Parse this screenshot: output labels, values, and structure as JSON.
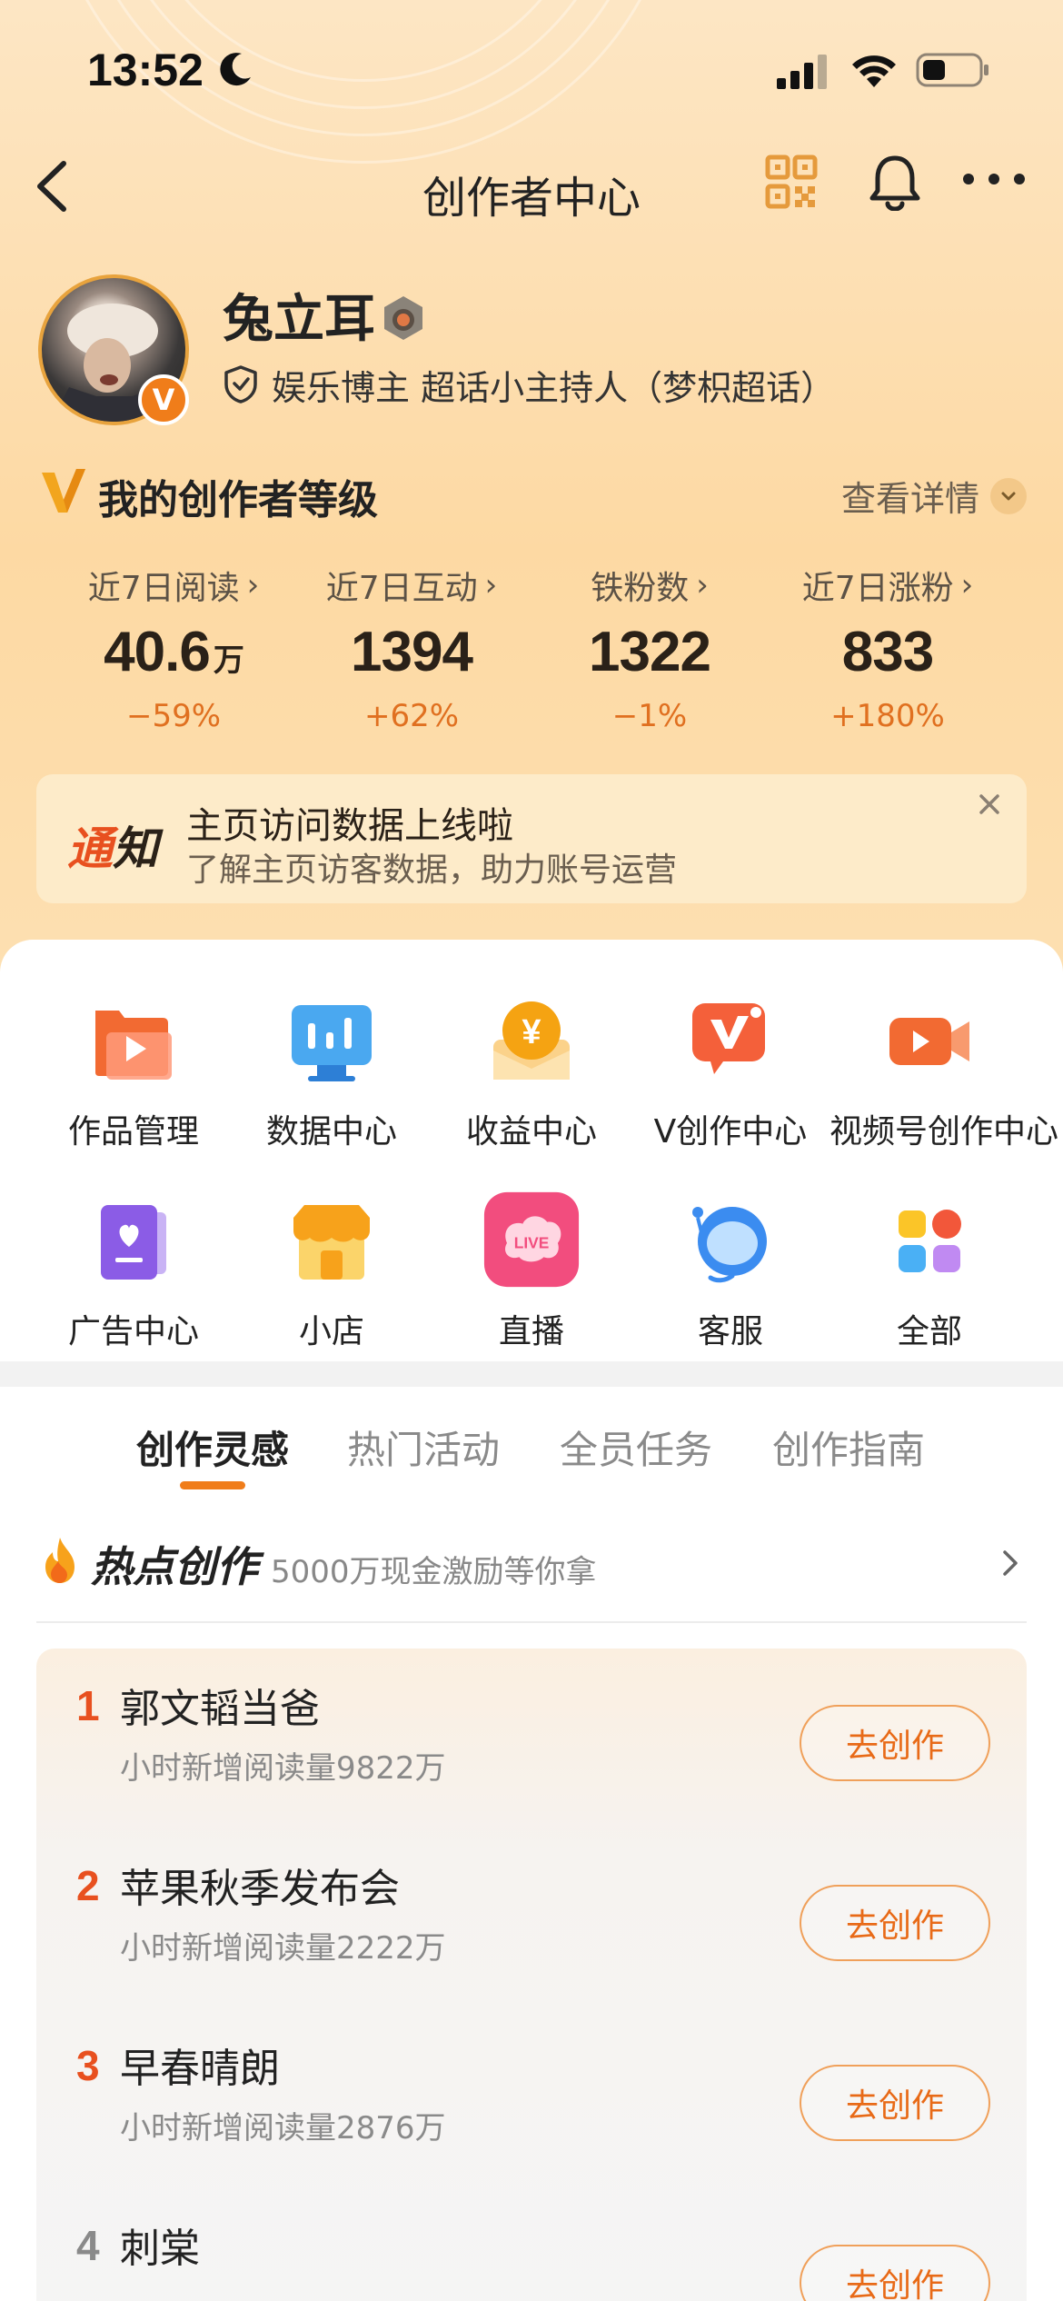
{
  "status_bar": {
    "time": "13:52"
  },
  "nav": {
    "title": "创作者中心"
  },
  "profile": {
    "username": "兔立耳",
    "avatar_badge": "V",
    "verification": "娱乐博主 超话小主持人（梦枳超话）"
  },
  "level": {
    "title": "我的创作者等级",
    "details_link": "查看详情"
  },
  "stats": [
    {
      "label": "近7日阅读",
      "value": "40.6",
      "unit": "万",
      "change": "−59%"
    },
    {
      "label": "近7日互动",
      "value": "1394",
      "unit": "",
      "change": "+62%"
    },
    {
      "label": "铁粉数",
      "value": "1322",
      "unit": "",
      "change": "−1%"
    },
    {
      "label": "近7日涨粉",
      "value": "833",
      "unit": "",
      "change": "+180%"
    }
  ],
  "notice": {
    "tag_part1": "通",
    "tag_part2": "知",
    "title": "主页访问数据上线啦",
    "subtitle": "了解主页访客数据，助力账号运营"
  },
  "tools": [
    {
      "label": "作品管理",
      "icon": "works-icon"
    },
    {
      "label": "数据中心",
      "icon": "data-icon"
    },
    {
      "label": "收益中心",
      "icon": "income-icon"
    },
    {
      "label": "V创作中心",
      "icon": "v-create-icon"
    },
    {
      "label": "视频号创作中心",
      "icon": "video-icon"
    },
    {
      "label": "广告中心",
      "icon": "ad-icon"
    },
    {
      "label": "小店",
      "icon": "shop-icon"
    },
    {
      "label": "直播",
      "icon": "live-icon",
      "icon_text": "LIVE"
    },
    {
      "label": "客服",
      "icon": "service-icon"
    },
    {
      "label": "全部",
      "icon": "all-icon"
    }
  ],
  "tabs": [
    "创作灵感",
    "热门活动",
    "全员任务",
    "创作指南"
  ],
  "hot": {
    "title": "热点创作",
    "subtitle": "5000万现金激励等你拿",
    "button_label": "去创作",
    "items": [
      {
        "rank": "1",
        "title": "郭文韬当爸",
        "sub": "小时新增阅读量9822万"
      },
      {
        "rank": "2",
        "title": "苹果秋季发布会",
        "sub": "小时新增阅读量2222万"
      },
      {
        "rank": "3",
        "title": "早春晴朗",
        "sub": "小时新增阅读量2876万"
      },
      {
        "rank": "4",
        "title": "刺棠",
        "sub": ""
      }
    ]
  },
  "colors": {
    "accent": "#f07d1a",
    "rank_top": "#e8501f",
    "rank_other": "#8a8a8a",
    "header_bg": "#fdd9a3"
  }
}
